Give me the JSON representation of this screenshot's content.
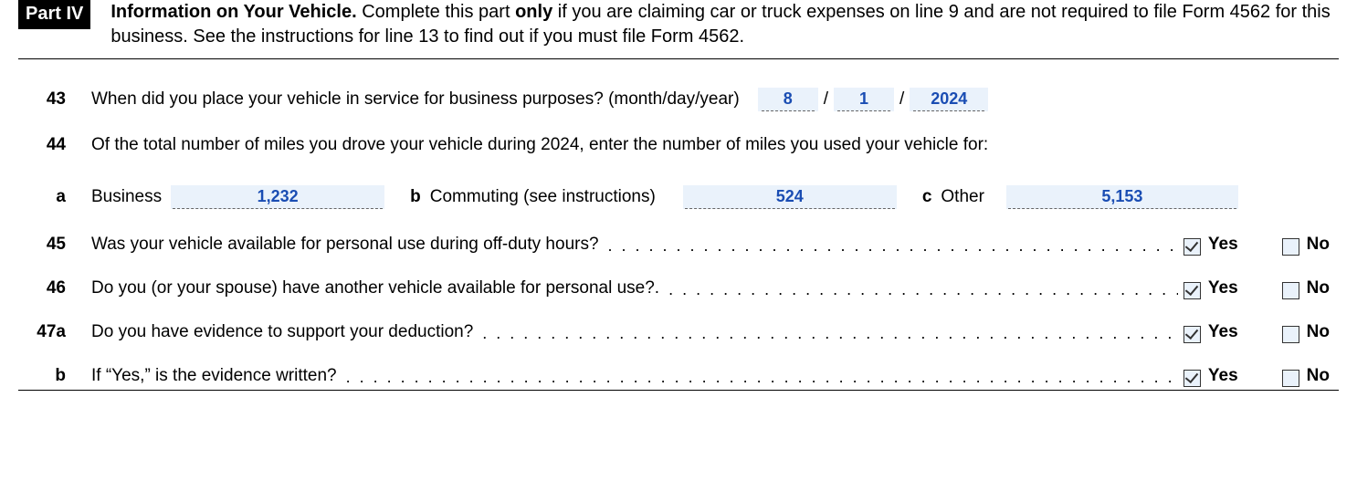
{
  "header": {
    "part_label": "Part IV",
    "title_bold": "Information on Your Vehicle.",
    "instr_1": " Complete this part ",
    "only": "only",
    "instr_2": " if you are claiming car or truck expenses on line 9 and are not required to file Form 4562 for this business. See the instructions for line 13 to find out if you must file Form 4562."
  },
  "line43": {
    "num": "43",
    "text": "When did you place your vehicle in service for business purposes? (month/day/year)",
    "month": "8",
    "day": "1",
    "year": "2024",
    "sep": "/"
  },
  "line44": {
    "num": "44",
    "text": "Of the total number of miles you drove your vehicle during 2024, enter the number of miles you used your vehicle for:",
    "a_label": "a",
    "a_text": "Business",
    "a_value": "1,232",
    "b_label": "b",
    "b_text": "Commuting (see instructions)",
    "b_value": "524",
    "c_label": "c",
    "c_text": "Other",
    "c_value": "5,153"
  },
  "line45": {
    "num": "45",
    "text": "Was your vehicle available for personal use during off-duty hours?",
    "yes": "Yes",
    "no": "No",
    "yes_checked": true,
    "no_checked": false
  },
  "line46": {
    "num": "46",
    "text": "Do you (or your spouse) have another vehicle available for personal use?.",
    "yes": "Yes",
    "no": "No",
    "yes_checked": true,
    "no_checked": false
  },
  "line47a": {
    "num": "47a",
    "text": "Do you have evidence to support your deduction?",
    "yes": "Yes",
    "no": "No",
    "yes_checked": true,
    "no_checked": false
  },
  "line47b": {
    "num": "b",
    "text": "If “Yes,” is the evidence written?",
    "yes": "Yes",
    "no": "No",
    "yes_checked": true,
    "no_checked": false
  }
}
